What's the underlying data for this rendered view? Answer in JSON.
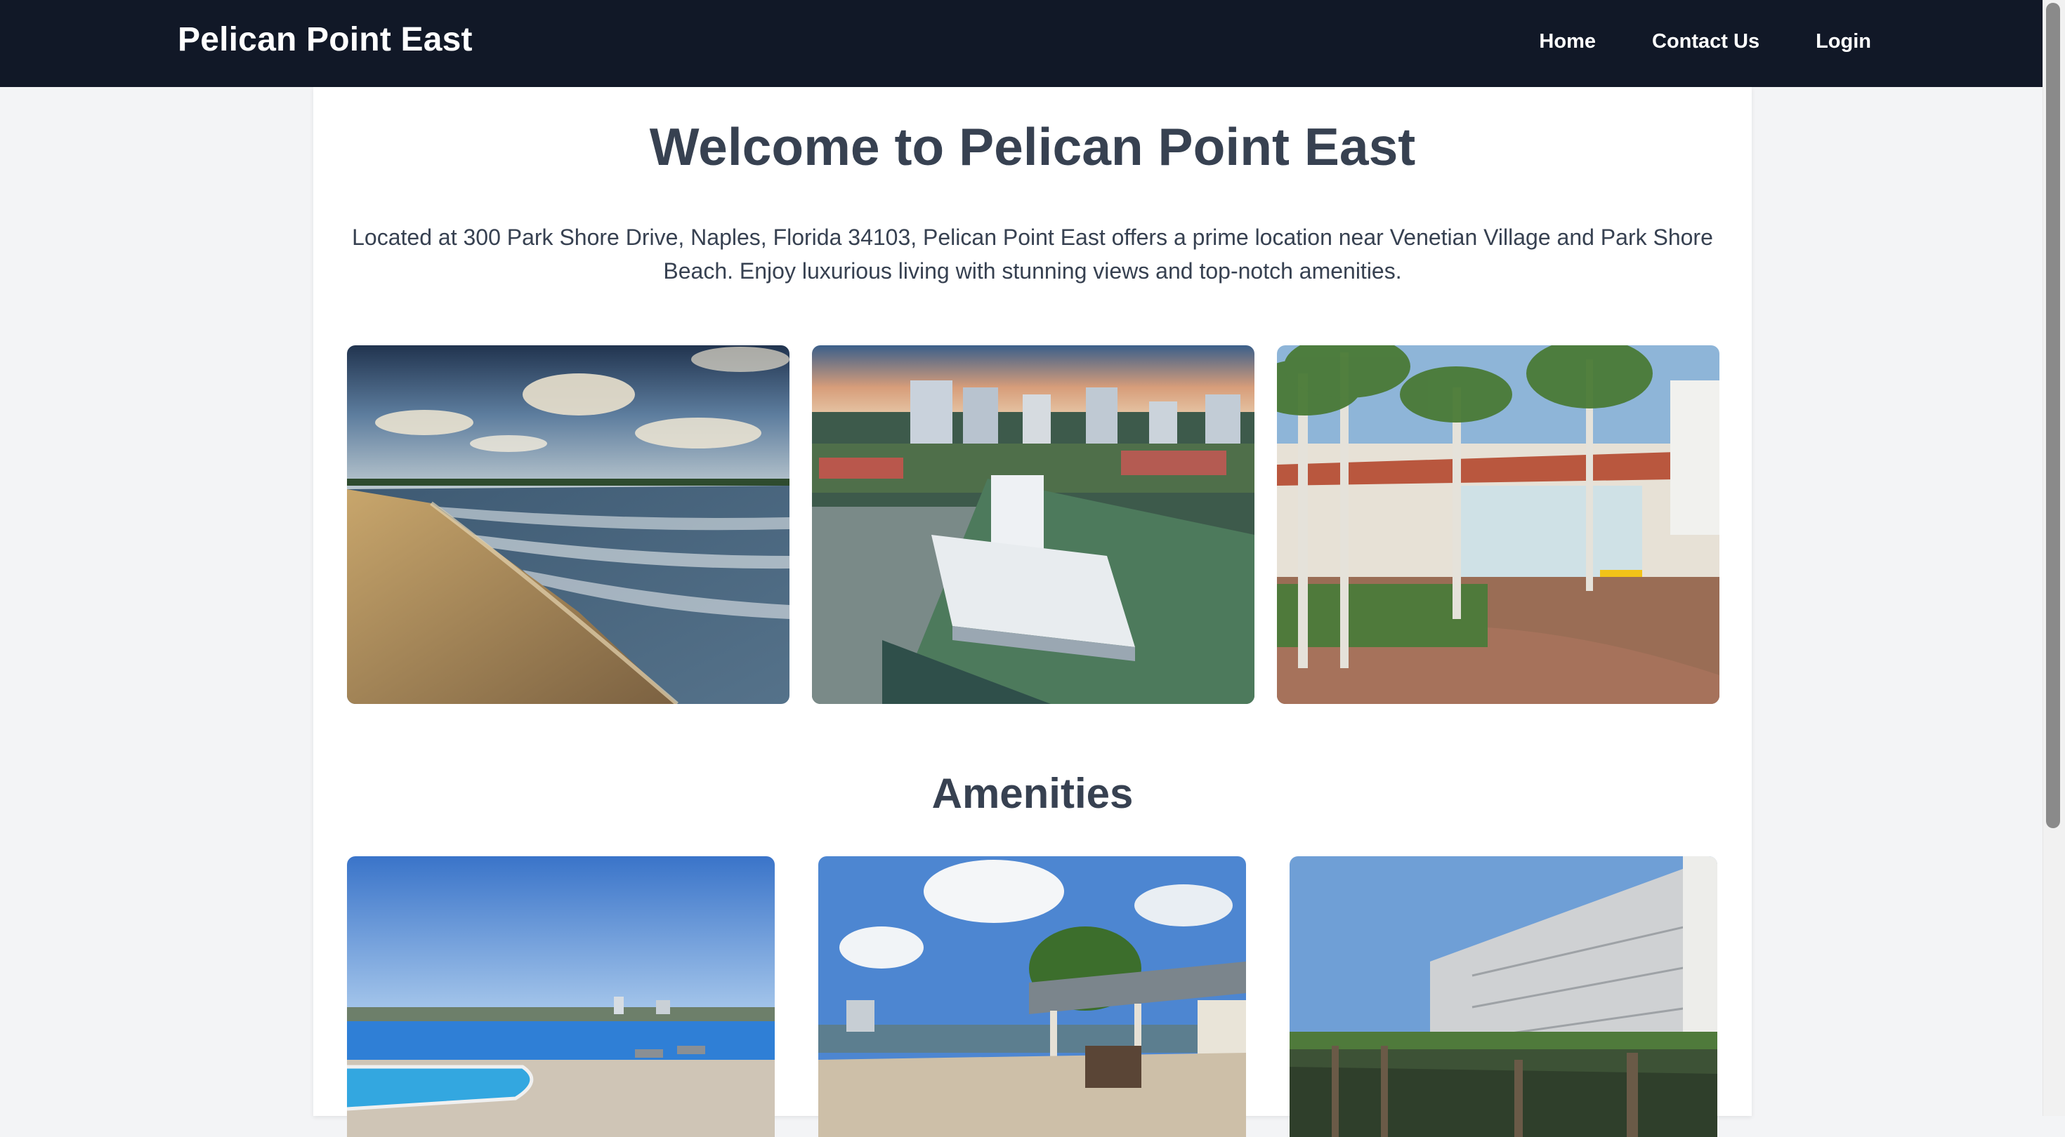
{
  "nav": {
    "brand": "Pelican Point East",
    "links": [
      "Home",
      "Contact Us",
      "Login"
    ]
  },
  "hero": {
    "title": "Welcome to Pelican Point East",
    "intro": "Located at 300 Park Shore Drive, Naples, Florida 34103, Pelican Point East offers a prime location near Venetian Village and Park Shore Beach. Enjoy luxurious living with stunning views and top-notch amenities."
  },
  "gallery": [
    {
      "name": "beach-photo"
    },
    {
      "name": "aerial-building-photo"
    },
    {
      "name": "venetian-village-photo"
    }
  ],
  "amenities": {
    "title": "Amenities",
    "items": [
      {
        "name": "pool-photo"
      },
      {
        "name": "clubhouse-pavilion-photo"
      },
      {
        "name": "boat-dock-photo"
      }
    ]
  },
  "colors": {
    "navbar": "#111827",
    "page_background": "#f3f4f6",
    "card": "#ffffff",
    "text": "#374151"
  }
}
